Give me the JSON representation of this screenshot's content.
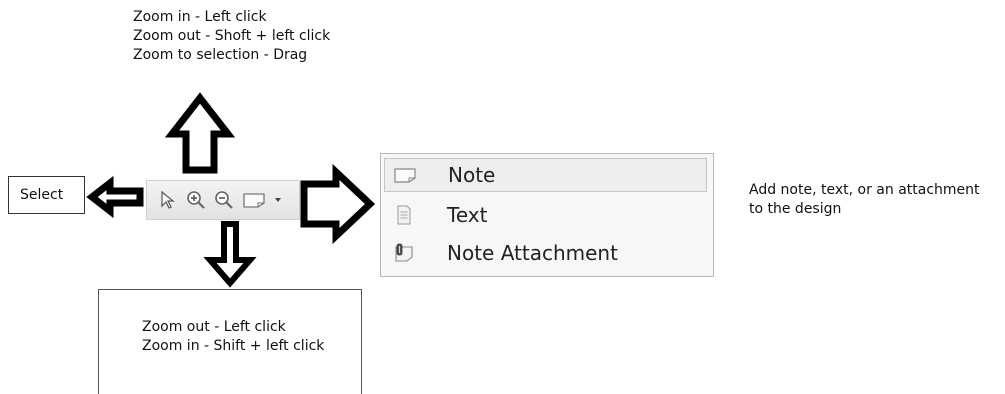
{
  "annotations": {
    "zoom_tool": [
      "Zoom in - Left click",
      "Zoom out - Shoft + left click",
      "Zoom to selection - Drag"
    ],
    "select_tool": "Select",
    "zoom_out_tool": [
      "Zoom out - Left click",
      "Zoom in - Shift + left click"
    ],
    "note_tool": [
      "Add note, text, or an attachment",
      "to the design"
    ]
  },
  "toolbar": {
    "buttons": [
      {
        "icon": "select-arrow-icon"
      },
      {
        "icon": "zoom-in-icon"
      },
      {
        "icon": "zoom-out-icon"
      },
      {
        "icon": "note-icon"
      },
      {
        "icon": "dropdown-caret-icon"
      }
    ]
  },
  "note_menu": {
    "items": [
      {
        "label": "Note",
        "icon": "note-icon",
        "highlighted": true
      },
      {
        "label": "Text",
        "icon": "text-document-icon",
        "highlighted": false
      },
      {
        "label": "Note Attachment",
        "icon": "attachment-icon",
        "highlighted": false
      }
    ]
  }
}
